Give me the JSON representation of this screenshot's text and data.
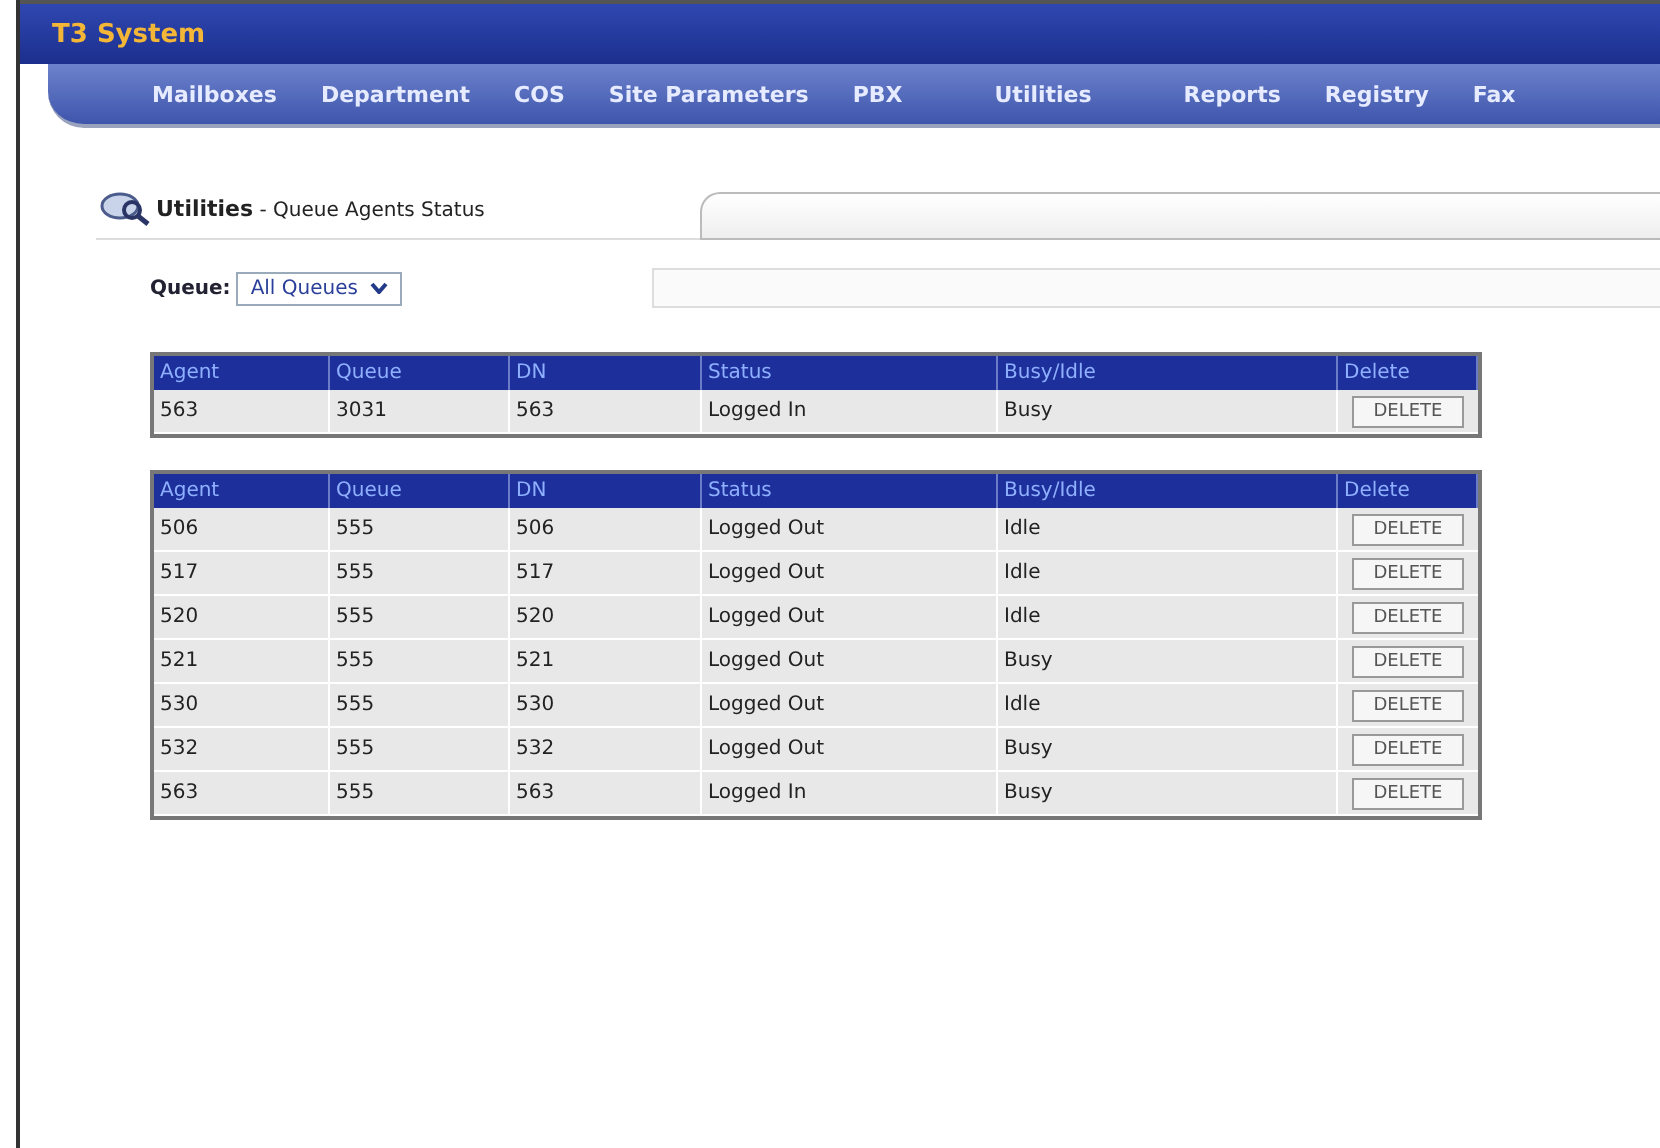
{
  "window": {
    "title": "T3 System"
  },
  "nav": [
    {
      "label": "Mailboxes"
    },
    {
      "label": "Department"
    },
    {
      "label": "COS"
    },
    {
      "label": "Site Parameters"
    },
    {
      "label": "PBX"
    },
    {
      "label": "Utilities"
    },
    {
      "label": "Reports"
    },
    {
      "label": "Registry"
    },
    {
      "label": "Fax"
    }
  ],
  "page_tab": {
    "section": "Utilities",
    "separator": " - ",
    "title": "Queue Agents Status"
  },
  "queue_filter": {
    "label": "Queue:",
    "value": "All Queues"
  },
  "tables": [
    {
      "columns": [
        "Agent",
        "Queue",
        "DN",
        "Status",
        "Busy/Idle",
        "Delete"
      ],
      "rows": [
        {
          "cells": [
            "563",
            "3031",
            "563",
            "Logged In",
            "Busy"
          ],
          "button": "DELETE"
        }
      ]
    },
    {
      "columns": [
        "Agent",
        "Queue",
        "DN",
        "Status",
        "Busy/Idle",
        "Delete"
      ],
      "rows": [
        {
          "cells": [
            "506",
            "555",
            "506",
            "Logged Out",
            "Idle"
          ],
          "button": "DELETE"
        },
        {
          "cells": [
            "517",
            "555",
            "517",
            "Logged Out",
            "Idle"
          ],
          "button": "DELETE"
        },
        {
          "cells": [
            "520",
            "555",
            "520",
            "Logged Out",
            "Idle"
          ],
          "button": "DELETE"
        },
        {
          "cells": [
            "521",
            "555",
            "521",
            "Logged Out",
            "Busy"
          ],
          "button": "DELETE"
        },
        {
          "cells": [
            "530",
            "555",
            "530",
            "Logged Out",
            "Idle"
          ],
          "button": "DELETE"
        },
        {
          "cells": [
            "532",
            "555",
            "532",
            "Logged Out",
            "Busy"
          ],
          "button": "DELETE"
        },
        {
          "cells": [
            "563",
            "555",
            "563",
            "Logged In",
            "Busy"
          ],
          "button": "DELETE"
        }
      ]
    }
  ]
}
